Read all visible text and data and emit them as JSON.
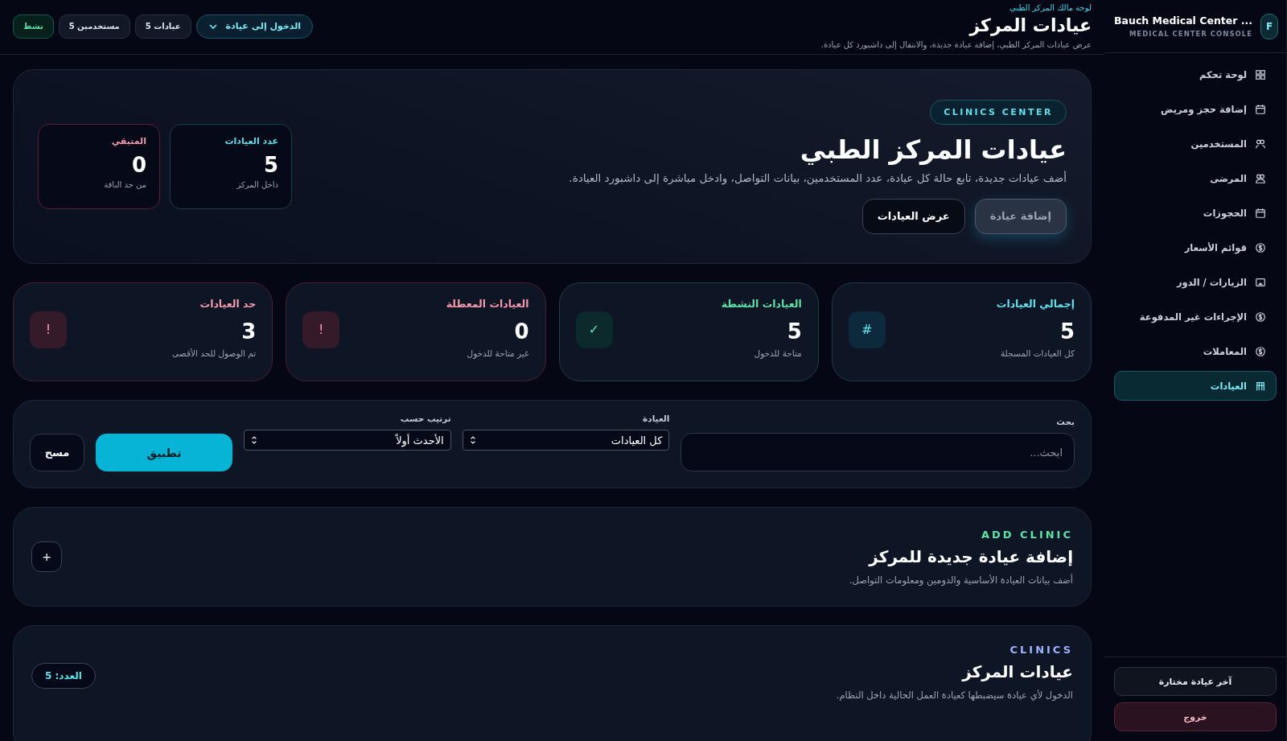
{
  "sidebar": {
    "avatar": "F",
    "title": "Bauch Medical Center ...",
    "subtitle": "MEDICAL CENTER CONSOLE",
    "items": [
      {
        "label": "لوحة تحكم",
        "selected": false
      },
      {
        "label": "إضافة حجز ومريض",
        "selected": false
      },
      {
        "label": "المستخدمين",
        "selected": false
      },
      {
        "label": "المرضى",
        "selected": false
      },
      {
        "label": "الحجوزات",
        "selected": false
      },
      {
        "label": "قوائم الأسعار",
        "selected": false
      },
      {
        "label": "الزيارات / الدور",
        "selected": false
      },
      {
        "label": "الإجراءات غير المدفوعة",
        "selected": false
      },
      {
        "label": "المعاملات",
        "selected": false
      },
      {
        "label": "العيادات",
        "selected": true
      }
    ],
    "footer_buttons": [
      {
        "label": "آخر عيادة مختارة",
        "kind": "neutral"
      },
      {
        "label": "خروج",
        "kind": "danger"
      }
    ]
  },
  "header": {
    "eyebrow": "لوحة مالك المركز الطبي",
    "title": "عيادات المركز",
    "subtitle": "عرض عيادات المركز الطبي، إضافة عيادة جديدة، والانتقال إلى داشبورد كل عيادة.",
    "dropdown": "الدخول إلى عيادة",
    "chips": [
      {
        "label": "عيادات 5",
        "kind": "neutral"
      },
      {
        "label": "مستخدمين 5",
        "kind": "neutral"
      },
      {
        "label": "نشط",
        "kind": "success"
      }
    ]
  },
  "hero": {
    "badge": "CLINICS CENTER",
    "title": "عيادات المركز الطبي",
    "description": "أضف عيادات جديدة، تابع حالة كل عيادة، عدد المستخدمين، بيانات التواصل، وادخل مباشرة إلى داشبورد العيادة.",
    "buttons": [
      {
        "label": "إضافة عيادة",
        "kind": "primary",
        "disabled": true
      },
      {
        "label": "عرض العيادات",
        "kind": "outline",
        "disabled": false
      }
    ],
    "mini_stats": [
      {
        "label": "عدد العيادات",
        "value": "5",
        "note": "داخل المركز",
        "kind": "info"
      },
      {
        "label": "المتبقي",
        "value": "0",
        "note": "من حد الباقة",
        "kind": "danger"
      }
    ]
  },
  "stats": [
    {
      "title": "إجمالي العيادات",
      "value": "5",
      "note": "كل العيادات المسجلة",
      "icon": "#",
      "kind": "info"
    },
    {
      "title": "العيادات النشطة",
      "value": "5",
      "note": "متاحة للدخول",
      "icon": "✓",
      "kind": "success"
    },
    {
      "title": "العيادات المعطلة",
      "value": "0",
      "note": "غير متاحة للدخول",
      "icon": "!",
      "kind": "danger"
    },
    {
      "title": "حد العيادات",
      "value": "3",
      "note": "تم الوصول للحد الأقصى",
      "icon": "!",
      "kind": "danger"
    }
  ],
  "filters": {
    "search": {
      "label": "بحث",
      "placeholder": "ابحث..."
    },
    "selects": [
      {
        "label": "العيادة",
        "value": "كل العيادات"
      },
      {
        "label": "ترتيب حسب",
        "value": "الأحدث أولاً"
      }
    ],
    "apply": "تطبيق",
    "clear": "مسح"
  },
  "add_clinic": {
    "eyebrow": "ADD CLINIC",
    "title": "إضافة عيادة جديدة للمركز",
    "description": "أضف بيانات العيادة الأساسية والدومين ومعلومات التواصل.",
    "button": "+"
  },
  "clinics": {
    "eyebrow": "CLINICS",
    "title": "عيادات المركز",
    "description": "الدخول لأي عيادة سيضبطها كعيادة العمل الحالية داخل النظام.",
    "count": "العدد: 5"
  }
}
